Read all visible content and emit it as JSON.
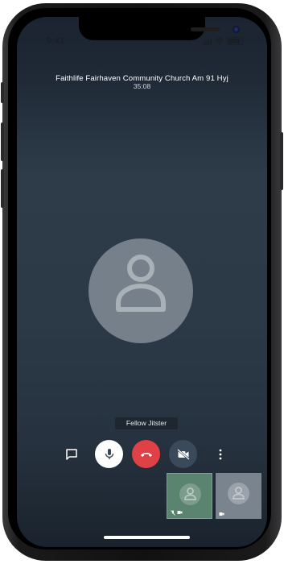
{
  "status_bar": {
    "time": "9:41"
  },
  "conference": {
    "title": "Faithlife Fairhaven Community Church Am 91 Hyj",
    "duration": "35:08"
  },
  "main_participant": {
    "name": "Fellow Jitster"
  },
  "toolbar": {
    "chat": "chat-icon",
    "mic": "microphone-icon",
    "hangup": "hangup-icon",
    "video": "video-off-icon",
    "more": "more-vertical-icon"
  },
  "thumbnails": [
    {
      "name": "local-participant",
      "muted": true,
      "video_off": true,
      "icon": "avatar-icon"
    },
    {
      "name": "remote-participant",
      "muted": false,
      "video_off": true,
      "icon": "avatar-icon"
    }
  ],
  "colors": {
    "hangup": "#e04146",
    "video_button": "#3a4a5a",
    "thumbnail_active": "#5a8470"
  }
}
